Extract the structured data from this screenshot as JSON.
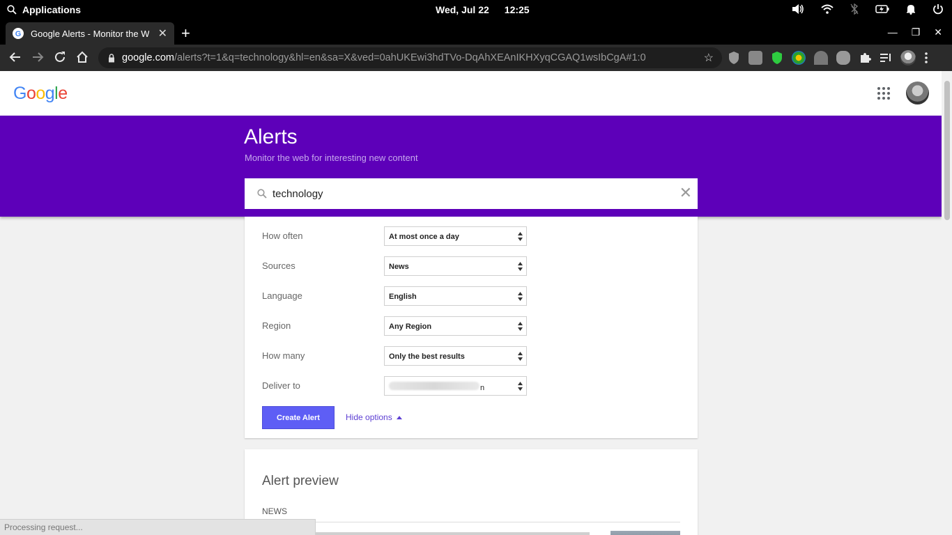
{
  "os": {
    "applications_label": "Applications",
    "date": "Wed, Jul 22",
    "time": "12:25"
  },
  "browser": {
    "tab_title": "Google Alerts - Monitor the Web",
    "url_host": "google.com",
    "url_path": "/alerts?t=1&q=technology&hl=en&sa=X&ved=0ahUKEwi3hdTVo-DqAhXEAnIKHXyqCGAQ1wsIbCgA#1:0"
  },
  "google": {
    "logo_text": "Google",
    "logo_colors": [
      "#4285F4",
      "#EA4335",
      "#FBBC05",
      "#4285F4",
      "#34A853",
      "#EA4335"
    ]
  },
  "banner": {
    "title": "Alerts",
    "subtitle": "Monitor the web for interesting new content",
    "color": "#5d00b9"
  },
  "search": {
    "query": "technology"
  },
  "options": [
    {
      "label": "How often",
      "value": "At most once a day"
    },
    {
      "label": "Sources",
      "value": "News"
    },
    {
      "label": "Language",
      "value": "English"
    },
    {
      "label": "Region",
      "value": "Any Region"
    },
    {
      "label": "How many",
      "value": "Only the best results"
    },
    {
      "label": "Deliver to",
      "value": "",
      "redacted": true,
      "visible_tail": "n"
    }
  ],
  "actions": {
    "create_label": "Create Alert",
    "hide_options_label": "Hide options"
  },
  "preview": {
    "title": "Alert preview",
    "category": "NEWS"
  },
  "status": {
    "text": "Processing request..."
  }
}
